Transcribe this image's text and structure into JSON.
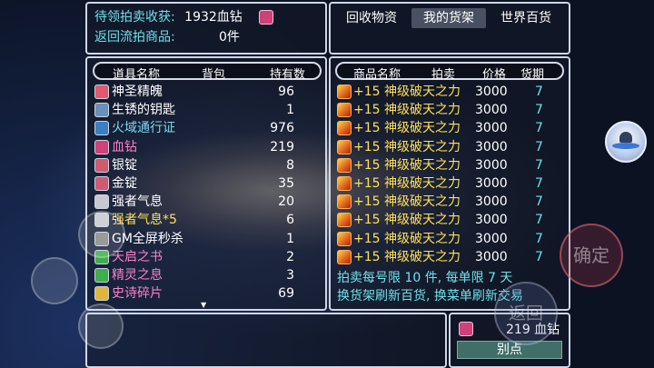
{
  "top_info": {
    "pending_label": "待领拍卖收获:",
    "pending_value": "1932血钻",
    "return_label": "返回流拍商品:",
    "return_value": "0件"
  },
  "tabs": [
    "回收物资",
    "我的货架",
    "世界百货"
  ],
  "active_tab": 1,
  "inventory": {
    "headers": {
      "name": "道具名称",
      "bag": "背包",
      "count": "持有数"
    },
    "items": [
      {
        "name": "神圣精魄",
        "count": "96",
        "color": "#ffffff",
        "icon": "heart-potion-icon",
        "icon_color": "#e05a6c"
      },
      {
        "name": "生锈的钥匙",
        "count": "1",
        "color": "#ffffff",
        "icon": "key-icon",
        "icon_color": "#6a8fb8"
      },
      {
        "name": "火域通行证",
        "count": "976",
        "color": "#7fd8f0",
        "icon": "pass-card-icon",
        "icon_color": "#3a7fc0"
      },
      {
        "name": "血钻",
        "count": "219",
        "color": "#ff7fc8",
        "icon": "blood-diamond-icon",
        "icon_color": "#d0407a"
      },
      {
        "name": "银锭",
        "count": "8",
        "color": "#ffffff",
        "icon": "silver-ingot-icon",
        "icon_color": "#d05a70"
      },
      {
        "name": "金锭",
        "count": "35",
        "color": "#ffffff",
        "icon": "gold-ingot-icon",
        "icon_color": "#d05a70"
      },
      {
        "name": "强者气息",
        "count": "20",
        "color": "#ffffff",
        "icon": "aura-orb-icon",
        "icon_color": "#c8c8d0"
      },
      {
        "name": "强者气息*5",
        "count": "6",
        "color": "#ffe05a",
        "icon": "aura-orb-icon",
        "icon_color": "#c8c8d0"
      },
      {
        "name": "GM全屏秒杀",
        "count": "1",
        "color": "#ffffff",
        "icon": "blank-scroll-icon",
        "icon_color": "#8a8a8a"
      },
      {
        "name": "天启之书",
        "count": "2",
        "color": "#ff7fc8",
        "icon": "book-icon",
        "icon_color": "#3fae4a"
      },
      {
        "name": "精灵之息",
        "count": "3",
        "color": "#ff7fc8",
        "icon": "spirit-orb-icon",
        "icon_color": "#3fae4a"
      },
      {
        "name": "史诗碎片",
        "count": "69",
        "color": "#ff7fc8",
        "icon": "epic-shard-icon",
        "icon_color": "#e2b43a"
      }
    ],
    "scroll_indicator": "▼"
  },
  "shelf": {
    "headers": {
      "name": "商品名称",
      "auction": "拍卖",
      "price": "价格",
      "period": "货期"
    },
    "items": [
      {
        "name": "+15 神级破天之力",
        "price": "3000",
        "period": "7"
      },
      {
        "name": "+15 神级破天之力",
        "price": "3000",
        "period": "7"
      },
      {
        "name": "+15 神级破天之力",
        "price": "3000",
        "period": "7"
      },
      {
        "name": "+15 神级破天之力",
        "price": "3000",
        "period": "7"
      },
      {
        "name": "+15 神级破天之力",
        "price": "3000",
        "period": "7"
      },
      {
        "name": "+15 神级破天之力",
        "price": "3000",
        "period": "7"
      },
      {
        "name": "+15 神级破天之力",
        "price": "3000",
        "period": "7"
      },
      {
        "name": "+15 神级破天之力",
        "price": "3000",
        "period": "7"
      },
      {
        "name": "+15 神级破天之力",
        "price": "3000",
        "period": "7"
      },
      {
        "name": "+15 神级破天之力",
        "price": "3000",
        "period": "7"
      }
    ],
    "note_line1": "拍卖每号限 10 件, 每单限   7  天",
    "note_line2": "换货架刷新百货, 换菜单刷新交易"
  },
  "currency": {
    "amount": "219 血钻",
    "button": "别点"
  },
  "overlay": {
    "confirm": "确定",
    "back": "返回"
  },
  "colors": {
    "cyan": "#6fe0ea",
    "pink": "#ff7fc8",
    "yellow": "#ffe05a"
  }
}
